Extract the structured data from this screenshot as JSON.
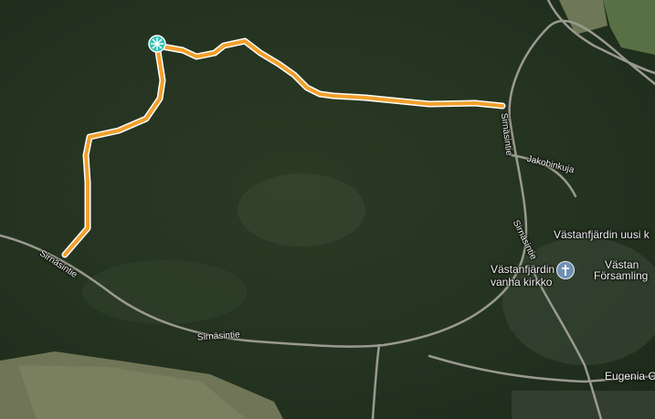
{
  "map": {
    "roads": {
      "sirnasintie_1": "Sirnäsintie",
      "sirnasintie_2": "Sirnäsintie",
      "sirnasintie_3": "Sirnäsintie",
      "sirnasintie_4": "Sirnäsintie",
      "jakobinkuja": "Jakobinkuja"
    },
    "places": {
      "vastanfjardin_uusi": "Västanfjärdin uusi k",
      "vanha_kirkko_line1": "Västanfjärdin",
      "vanha_kirkko_line2": "vanha kirkko",
      "forsamling_line1": "Västan",
      "forsamling_line2": "Församling",
      "eugenia": "Eugenia C"
    },
    "icons": {
      "start_marker": "start-marker-icon",
      "church": "church-icon"
    },
    "colors": {
      "track": "#f2a02c",
      "track_outline": "#ffffff",
      "start_marker": "#2ec4b6",
      "road": "#9a9a8e"
    }
  }
}
